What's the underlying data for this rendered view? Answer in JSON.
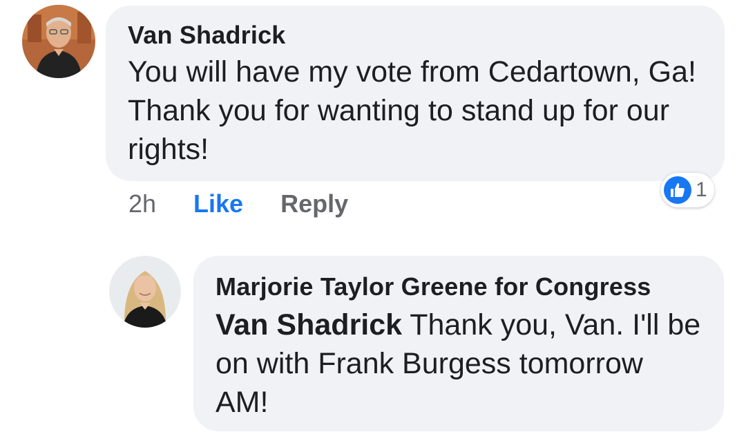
{
  "comments": [
    {
      "author": "Van Shadrick",
      "text": "You will have my vote from Cedartown, Ga! Thank you for wanting to stand up for our rights!",
      "time": "2h",
      "like_label": "Like",
      "reply_label": "Reply",
      "reaction": {
        "icon": "thumbs-up-icon",
        "count": "1",
        "color": "#1877f2"
      }
    },
    {
      "author": "Marjorie Taylor Greene for Congress",
      "mention": "Van Shadrick",
      "text": " Thank you, Van. I'll be on with Frank Burgess tomorrow AM!"
    }
  ],
  "colors": {
    "bubble": "#f0f2f5",
    "like_active": "#1877f2",
    "secondary_text": "#65676b",
    "primary_text": "#1c1e21"
  }
}
